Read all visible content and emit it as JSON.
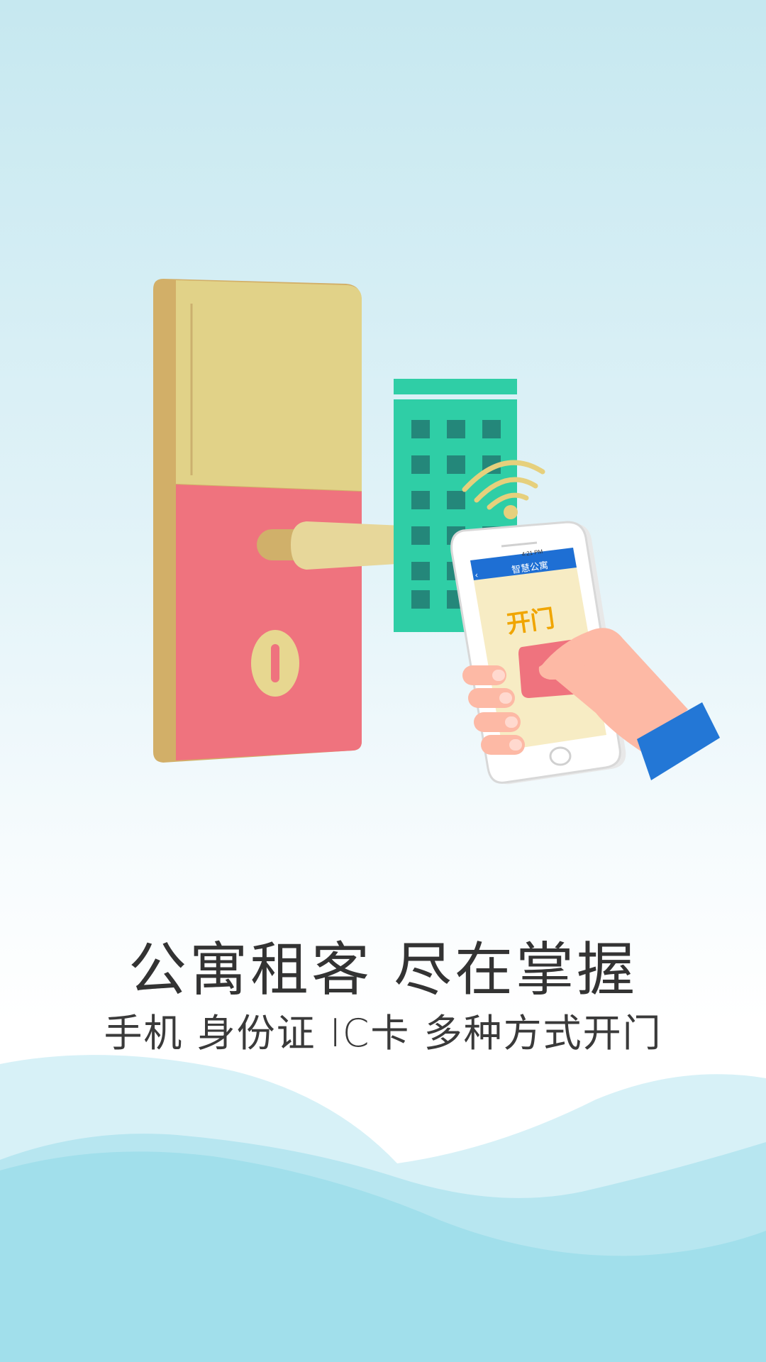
{
  "headline": {
    "title": "公寓租客 尽在掌握",
    "subtitle": "手机 身份证 IC卡 多种方式开门"
  },
  "phone_screen": {
    "app_title": "智慧公寓",
    "status_time": "4:21 PM",
    "open_door_label": "开门"
  },
  "icons": {
    "door_lock": "door-lock-icon",
    "building": "building-icon",
    "wifi": "wifi-signal-icon",
    "phone": "smartphone-icon",
    "hand": "hand-icon",
    "wave": "wave-decoration"
  },
  "colors": {
    "lock_gold": "#e1d288",
    "lock_red": "#ef737e",
    "building_green": "#2fcea6",
    "window_dark": "#24877a",
    "phone_blue": "#1e6fd4",
    "open_text": "#f0a500",
    "sleeve_blue": "#2377d6",
    "skin": "#fdb9a5",
    "wave_light": "#bfe8f2",
    "wave_dark": "#9ddbe8"
  }
}
